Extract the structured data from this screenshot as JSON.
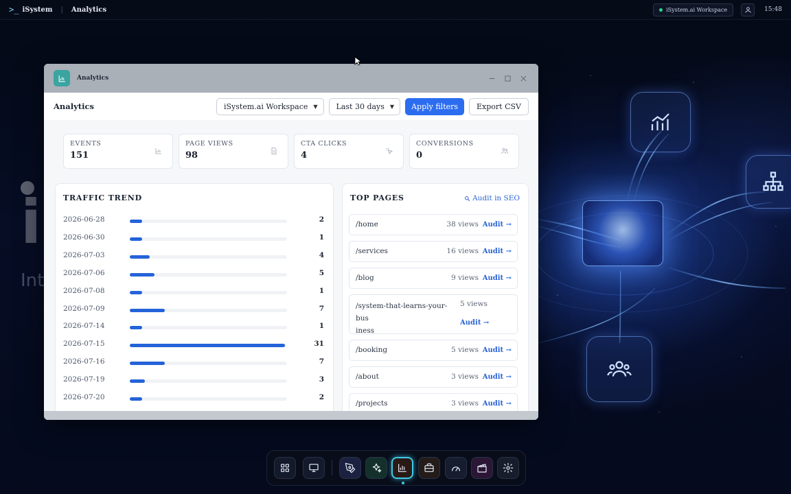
{
  "topbar": {
    "brand": "iSystem",
    "breadcrumb": "Analytics",
    "workspace_chip": "iSystem.ai Workspace",
    "clock": "15:48"
  },
  "desktop": {
    "hero_big": "i",
    "hero_sub": "Int"
  },
  "window": {
    "title": "Analytics",
    "toolbar": {
      "title": "Analytics",
      "workspace_select": "iSystem.ai Workspace",
      "range_select": "Last 30 days",
      "apply_label": "Apply filters",
      "export_label": "Export CSV"
    },
    "stats": [
      {
        "label": "EVENTS",
        "value": "151",
        "icon": "bar-chart-icon"
      },
      {
        "label": "PAGE VIEWS",
        "value": "98",
        "icon": "document-icon"
      },
      {
        "label": "CTA CLICKS",
        "value": "4",
        "icon": "pointer-click-icon"
      },
      {
        "label": "CONVERSIONS",
        "value": "0",
        "icon": "users-icon"
      }
    ],
    "traffic_trend": {
      "title": "TRAFFIC TREND",
      "max": 31,
      "rows": [
        {
          "date": "2026-06-28",
          "value": 2
        },
        {
          "date": "2026-06-30",
          "value": 1
        },
        {
          "date": "2026-07-03",
          "value": 4
        },
        {
          "date": "2026-07-06",
          "value": 5
        },
        {
          "date": "2026-07-08",
          "value": 1
        },
        {
          "date": "2026-07-09",
          "value": 7
        },
        {
          "date": "2026-07-14",
          "value": 1
        },
        {
          "date": "2026-07-15",
          "value": 31
        },
        {
          "date": "2026-07-16",
          "value": 7
        },
        {
          "date": "2026-07-19",
          "value": 3
        },
        {
          "date": "2026-07-20",
          "value": 2
        }
      ]
    },
    "top_pages": {
      "title": "TOP PAGES",
      "audit_seo_label": "Audit in SEO",
      "audit_label": "Audit →",
      "rows": [
        {
          "path": "/home",
          "views": "38 views"
        },
        {
          "path": "/services",
          "views": "16 views"
        },
        {
          "path": "/blog",
          "views": "9 views"
        },
        {
          "path": "/system-that-learns-your-business",
          "path_line1": "/system-that-learns-your-bus",
          "path_line2": "iness",
          "views": "5 views"
        },
        {
          "path": "/booking",
          "views": "5 views"
        },
        {
          "path": "/about",
          "views": "3 views"
        },
        {
          "path": "/projects",
          "views": "3 views"
        }
      ]
    }
  },
  "colors": {
    "accent": "#2c6df0",
    "bar": "#2463d9",
    "dock_active": "#3fc9e8"
  },
  "dock": {
    "items": [
      {
        "name": "apps-grid-icon"
      },
      {
        "name": "monitor-icon"
      },
      {
        "name": "pen-tool-icon"
      },
      {
        "name": "sparkles-icon"
      },
      {
        "name": "analytics-icon",
        "active": true
      },
      {
        "name": "briefcase-icon"
      },
      {
        "name": "speedometer-icon"
      },
      {
        "name": "clapperboard-icon"
      },
      {
        "name": "settings-gear-icon"
      }
    ]
  }
}
